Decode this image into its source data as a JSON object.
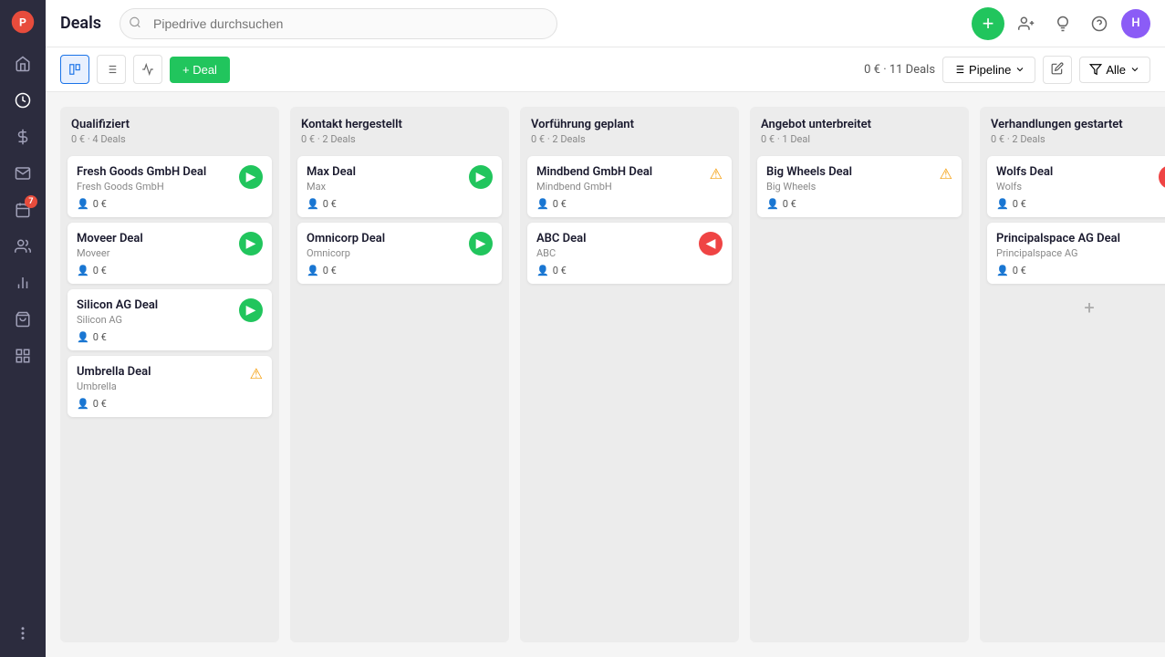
{
  "app": {
    "title": "Deals"
  },
  "search": {
    "placeholder": "Pipedrive durchsuchen"
  },
  "topbar": {
    "add_button_label": "+",
    "avatar_label": "H",
    "pipeline_label": "Pipeline",
    "filter_label": "Alle",
    "deals_summary": "0 €  ·  11 Deals",
    "add_deal_label": "+ Deal"
  },
  "sidebar": {
    "items": [
      {
        "name": "home",
        "icon": "home",
        "active": false
      },
      {
        "name": "activity",
        "icon": "activity",
        "active": false
      },
      {
        "name": "deals",
        "icon": "deals",
        "active": true
      },
      {
        "name": "mail",
        "icon": "mail",
        "active": false
      },
      {
        "name": "calendar",
        "icon": "calendar",
        "active": false,
        "badge": "7"
      },
      {
        "name": "contacts",
        "icon": "contacts",
        "active": false
      },
      {
        "name": "reports",
        "icon": "reports",
        "active": false
      },
      {
        "name": "products",
        "icon": "products",
        "active": false
      },
      {
        "name": "marketplace",
        "icon": "marketplace",
        "active": false
      },
      {
        "name": "more",
        "icon": "more",
        "active": false
      }
    ]
  },
  "board": {
    "columns": [
      {
        "id": "qualifiziert",
        "title": "Qualifiziert",
        "meta": "0 €  ·  4 Deals",
        "cards": [
          {
            "id": "fresh-goods",
            "title": "Fresh Goods GmbH Deal",
            "company": "Fresh Goods GmbH",
            "amount": "0 €",
            "indicator": "green",
            "indicator_type": "arrow"
          },
          {
            "id": "moveer",
            "title": "Moveer Deal",
            "company": "Moveer",
            "amount": "0 €",
            "indicator": "green",
            "indicator_type": "arrow"
          },
          {
            "id": "silicon-ag",
            "title": "Silicon AG Deal",
            "company": "Silicon AG",
            "amount": "0 €",
            "indicator": "green",
            "indicator_type": "arrow"
          },
          {
            "id": "umbrella",
            "title": "Umbrella Deal",
            "company": "Umbrella",
            "amount": "0 €",
            "indicator": "warning",
            "indicator_type": "warning"
          }
        ]
      },
      {
        "id": "kontakt",
        "title": "Kontakt hergestellt",
        "meta": "0 €  ·  2 Deals",
        "cards": [
          {
            "id": "max",
            "title": "Max Deal",
            "company": "Max",
            "amount": "0 €",
            "indicator": "green",
            "indicator_type": "arrow"
          },
          {
            "id": "omnicorp",
            "title": "Omnicorp Deal",
            "company": "Omnicorp",
            "amount": "0 €",
            "indicator": "green",
            "indicator_type": "arrow"
          }
        ]
      },
      {
        "id": "vorfuehrung",
        "title": "Vorführung geplant",
        "meta": "0 €  ·  2 Deals",
        "cards": [
          {
            "id": "mindbend",
            "title": "Mindbend GmbH Deal",
            "company": "Mindbend GmbH",
            "amount": "0 €",
            "indicator": "warning",
            "indicator_type": "warning"
          },
          {
            "id": "abc",
            "title": "ABC Deal",
            "company": "ABC",
            "amount": "0 €",
            "indicator": "red",
            "indicator_type": "arrow-left"
          }
        ]
      },
      {
        "id": "angebot",
        "title": "Angebot unterbreitet",
        "meta": "0 €  ·  1 Deal",
        "cards": [
          {
            "id": "bigwheels",
            "title": "Big Wheels Deal",
            "company": "Big Wheels",
            "amount": "0 €",
            "indicator": "warning",
            "indicator_type": "warning"
          }
        ]
      },
      {
        "id": "verhandlungen",
        "title": "Verhandlungen gestartet",
        "meta": "0 €  ·  2 Deals",
        "cards": [
          {
            "id": "wolfs",
            "title": "Wolfs Deal",
            "company": "Wolfs",
            "amount": "0 €",
            "indicator": "red",
            "indicator_type": "arrow-left"
          },
          {
            "id": "principalspace",
            "title": "Principalspace AG Deal",
            "company": "Principalspace AG",
            "amount": "0 €",
            "indicator": "warning",
            "indicator_type": "warning"
          }
        ],
        "show_add": true
      }
    ]
  }
}
